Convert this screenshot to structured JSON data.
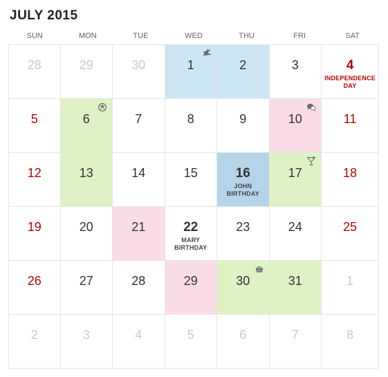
{
  "title": "JULY 2015",
  "dayHeaders": [
    "SUN",
    "MON",
    "TUE",
    "WED",
    "THU",
    "FRI",
    "SAT"
  ],
  "days": [
    {
      "n": "28",
      "other": true
    },
    {
      "n": "29",
      "other": true
    },
    {
      "n": "30",
      "other": true
    },
    {
      "n": "1",
      "bg": "blue",
      "icon": "airplane-icon"
    },
    {
      "n": "2",
      "bg": "blue"
    },
    {
      "n": "3"
    },
    {
      "n": "4",
      "weekend": true,
      "strong": true,
      "label": "INDEPENDENCE DAY"
    },
    {
      "n": "5",
      "weekend": true
    },
    {
      "n": "6",
      "bg": "green",
      "icon": "soccer-icon"
    },
    {
      "n": "7"
    },
    {
      "n": "8"
    },
    {
      "n": "9"
    },
    {
      "n": "10",
      "bg": "pink",
      "icon": "chat-icon"
    },
    {
      "n": "11",
      "weekend": true
    },
    {
      "n": "12",
      "weekend": true
    },
    {
      "n": "13",
      "bg": "green"
    },
    {
      "n": "14"
    },
    {
      "n": "15"
    },
    {
      "n": "16",
      "bg": "darkblue",
      "strong": true,
      "label": "JOHN BIRTHDAY"
    },
    {
      "n": "17",
      "bg": "green",
      "icon": "cocktail-icon"
    },
    {
      "n": "18",
      "weekend": true
    },
    {
      "n": "19",
      "weekend": true
    },
    {
      "n": "20"
    },
    {
      "n": "21",
      "bg": "pink"
    },
    {
      "n": "22",
      "strong": true,
      "label": "MARY BIRTHDAY"
    },
    {
      "n": "23"
    },
    {
      "n": "24"
    },
    {
      "n": "25",
      "weekend": true
    },
    {
      "n": "26",
      "weekend": true
    },
    {
      "n": "27"
    },
    {
      "n": "28"
    },
    {
      "n": "29",
      "bg": "pink"
    },
    {
      "n": "30",
      "bg": "green",
      "icon": "basket-icon"
    },
    {
      "n": "31",
      "bg": "green"
    },
    {
      "n": "1",
      "other": true
    },
    {
      "n": "2",
      "other": true
    },
    {
      "n": "3",
      "other": true
    },
    {
      "n": "4",
      "other": true
    },
    {
      "n": "5",
      "other": true
    },
    {
      "n": "6",
      "other": true
    },
    {
      "n": "7",
      "other": true
    },
    {
      "n": "8",
      "other": true
    }
  ]
}
